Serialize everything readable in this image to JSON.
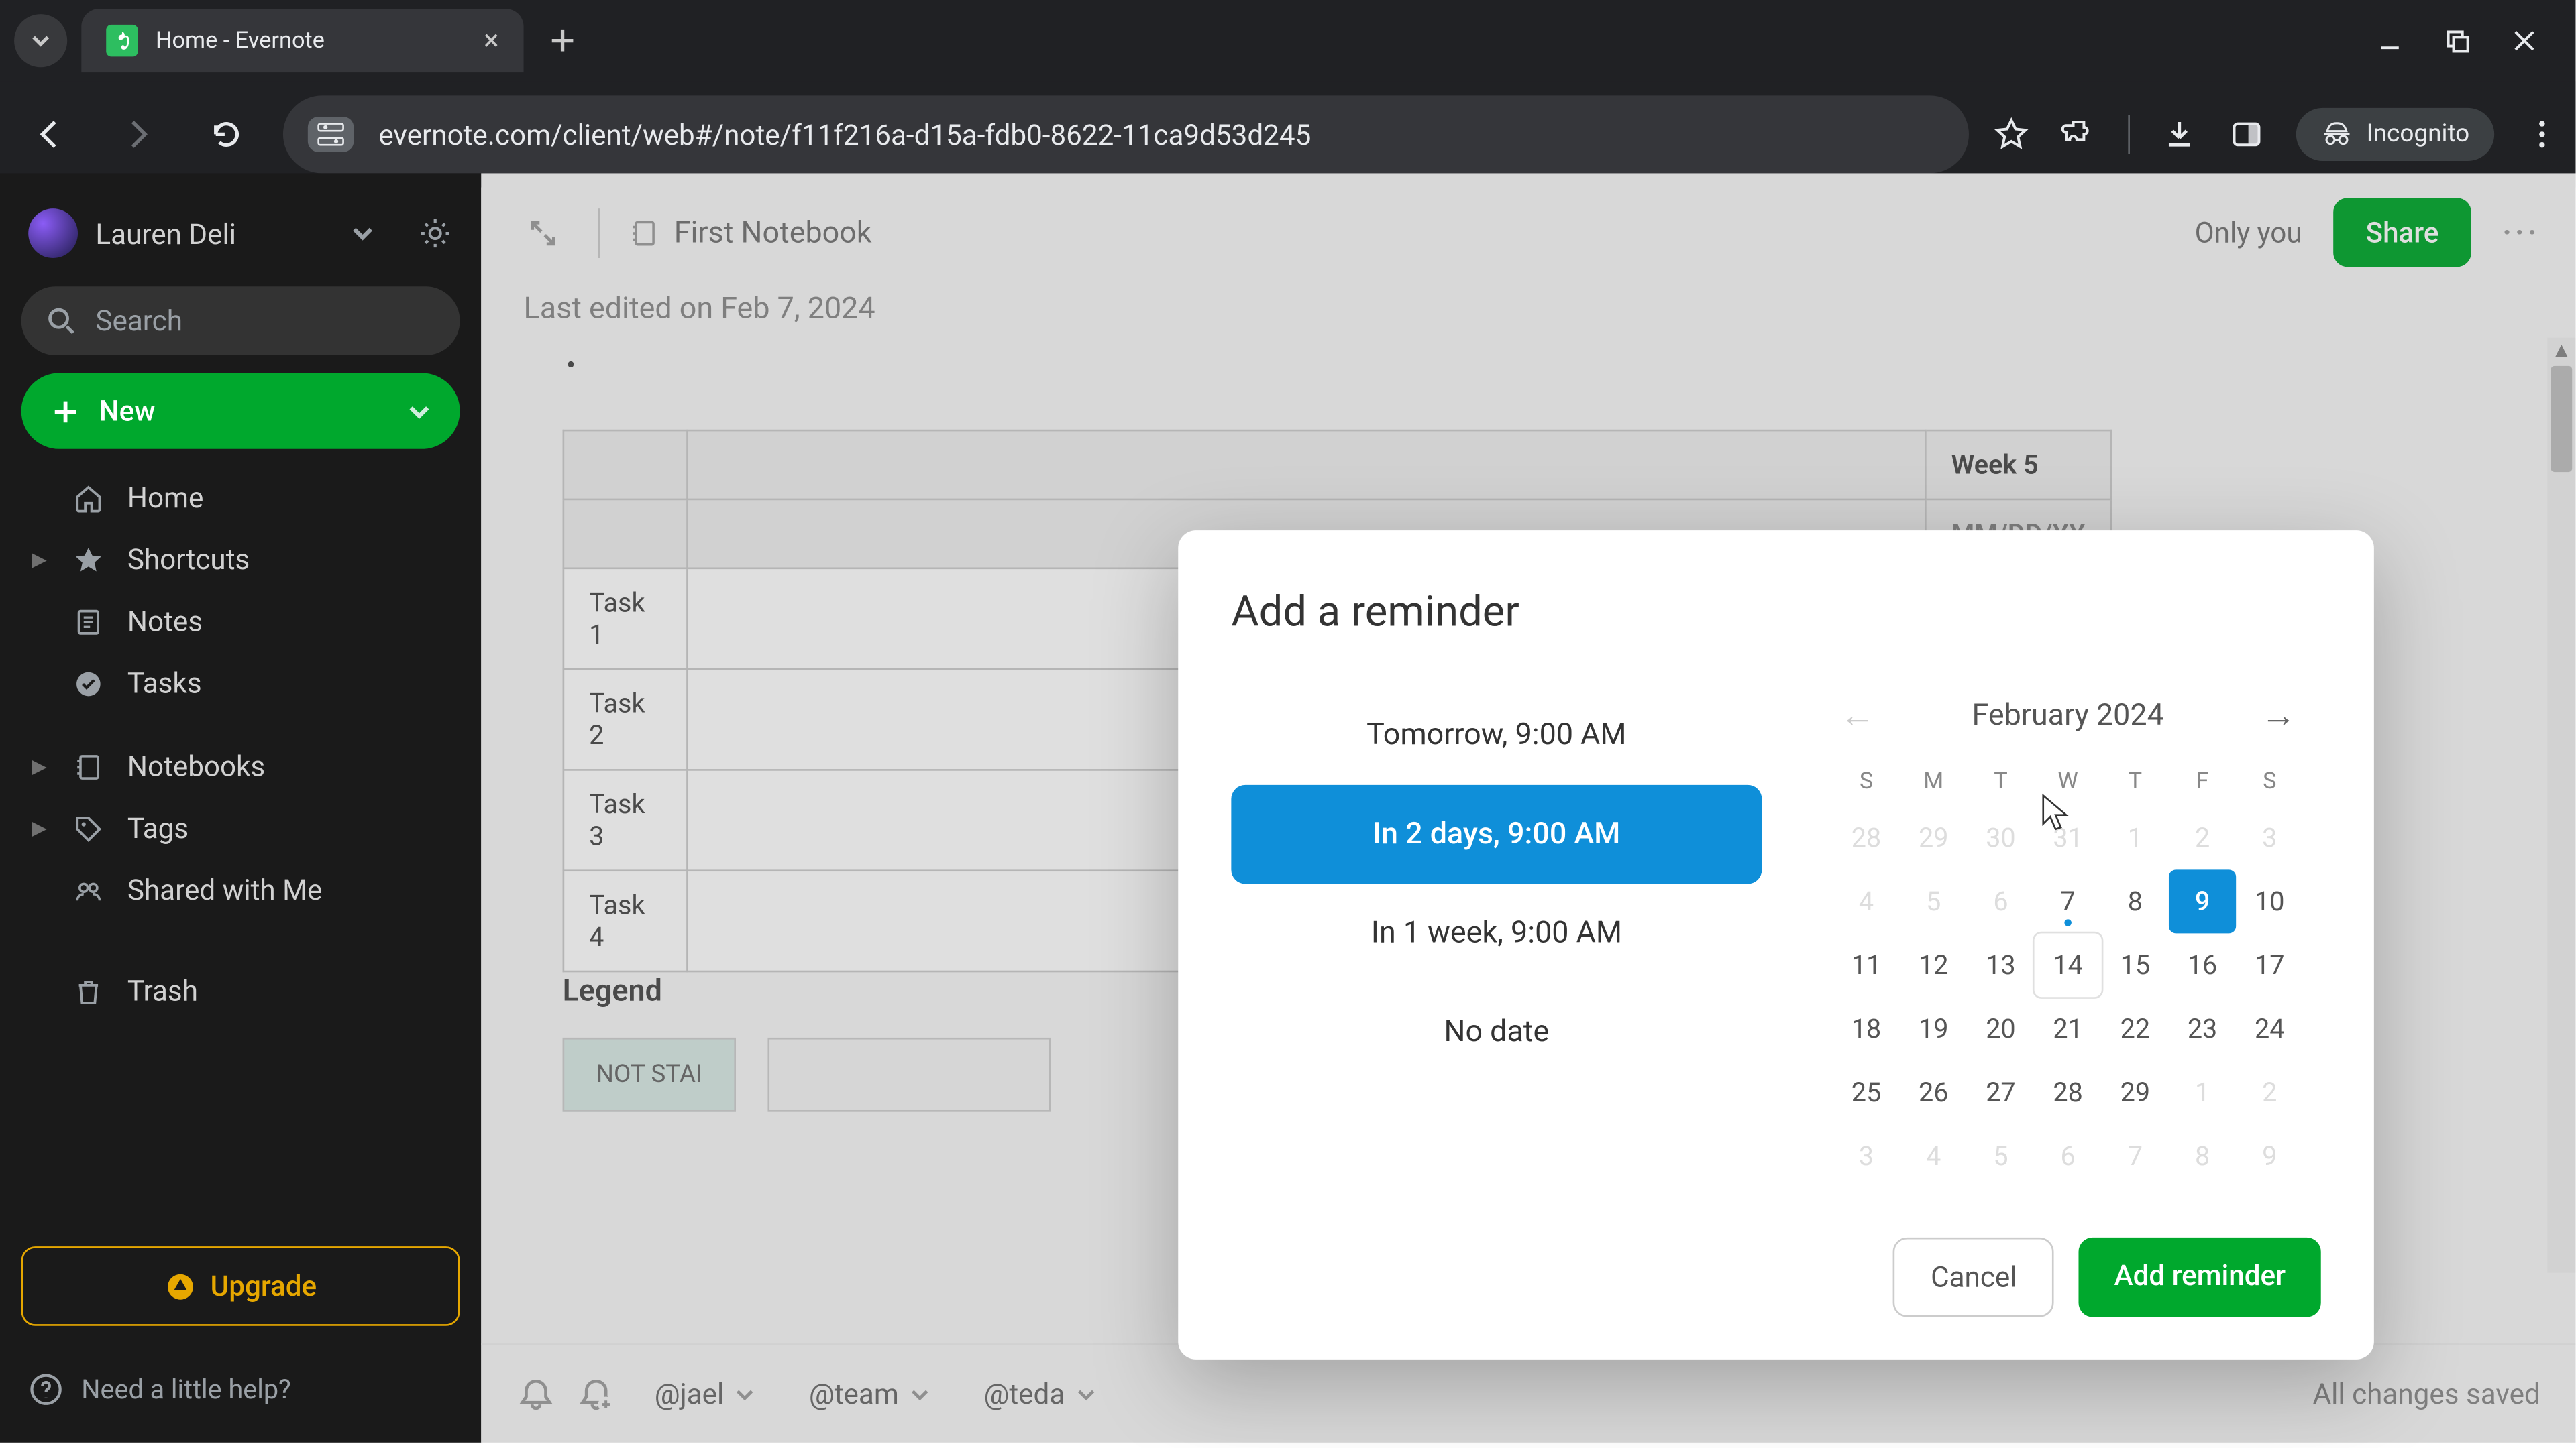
{
  "browser": {
    "tab_title": "Home - Evernote",
    "url": "evernote.com/client/web#/note/f11f216a-d15a-fdb0-8622-11ca9d53d245",
    "incognito": "Incognito"
  },
  "sidebar": {
    "user": "Lauren Deli",
    "search_placeholder": "Search",
    "new_label": "New",
    "items": [
      {
        "label": "Home",
        "icon": "home-icon",
        "expandable": false
      },
      {
        "label": "Shortcuts",
        "icon": "star-icon",
        "expandable": true
      },
      {
        "label": "Notes",
        "icon": "note-icon",
        "expandable": false
      },
      {
        "label": "Tasks",
        "icon": "check-icon",
        "expandable": false
      },
      {
        "label": "Notebooks",
        "icon": "notebook-icon",
        "expandable": true
      },
      {
        "label": "Tags",
        "icon": "tag-icon",
        "expandable": true
      },
      {
        "label": "Shared with Me",
        "icon": "shared-icon",
        "expandable": false
      }
    ],
    "trash": "Trash",
    "upgrade": "Upgrade",
    "help": "Need a little help?"
  },
  "note": {
    "notebook": "First Notebook",
    "only_you": "Only you",
    "share": "Share",
    "last_edited": "Last edited on Feb 7, 2024",
    "table_header_week": "Week 5",
    "table_header_date": "MM/DD/YY",
    "tasks": [
      "Task 1",
      "Task 2",
      "Task 3",
      "Task 4"
    ],
    "legend_title": "Legend",
    "legend_not_started": "NOT STAI",
    "mentions": [
      "@jael",
      "@team",
      "@teda"
    ],
    "saved": "All changes saved"
  },
  "modal": {
    "title": "Add a reminder",
    "quick": [
      {
        "label": "Tomorrow, 9:00 AM",
        "selected": false
      },
      {
        "label": "In 2 days, 9:00 AM",
        "selected": true
      },
      {
        "label": "In 1 week, 9:00 AM",
        "selected": false
      },
      {
        "label": "No date",
        "selected": false
      }
    ],
    "calendar": {
      "month_label": "February 2024",
      "prev_enabled": false,
      "next_enabled": true,
      "dow": [
        "S",
        "M",
        "T",
        "W",
        "T",
        "F",
        "S"
      ],
      "cells": [
        {
          "n": 28,
          "fade": true
        },
        {
          "n": 29,
          "fade": true
        },
        {
          "n": 30,
          "fade": true
        },
        {
          "n": 31,
          "fade": true
        },
        {
          "n": 1,
          "fade": true
        },
        {
          "n": 2,
          "fade": true
        },
        {
          "n": 3,
          "fade": true
        },
        {
          "n": 4,
          "fade": true
        },
        {
          "n": 5,
          "fade": true
        },
        {
          "n": 6,
          "fade": true
        },
        {
          "n": 7,
          "today": true
        },
        {
          "n": 8
        },
        {
          "n": 9,
          "selected": true
        },
        {
          "n": 10
        },
        {
          "n": 11
        },
        {
          "n": 12
        },
        {
          "n": 13
        },
        {
          "n": 14,
          "hover": true
        },
        {
          "n": 15
        },
        {
          "n": 16
        },
        {
          "n": 17
        },
        {
          "n": 18
        },
        {
          "n": 19
        },
        {
          "n": 20
        },
        {
          "n": 21
        },
        {
          "n": 22
        },
        {
          "n": 23
        },
        {
          "n": 24
        },
        {
          "n": 25
        },
        {
          "n": 26
        },
        {
          "n": 27
        },
        {
          "n": 28
        },
        {
          "n": 29
        },
        {
          "n": 1,
          "fade": true
        },
        {
          "n": 2,
          "fade": true
        },
        {
          "n": 3,
          "fade": true
        },
        {
          "n": 4,
          "fade": true
        },
        {
          "n": 5,
          "fade": true
        },
        {
          "n": 6,
          "fade": true
        },
        {
          "n": 7,
          "fade": true
        },
        {
          "n": 8,
          "fade": true
        },
        {
          "n": 9,
          "fade": true
        }
      ]
    },
    "cancel": "Cancel",
    "confirm": "Add reminder"
  },
  "colors": {
    "accent_green": "#00a82d",
    "accent_blue": "#0f8fd9",
    "upgrade_gold": "#e6a700"
  }
}
